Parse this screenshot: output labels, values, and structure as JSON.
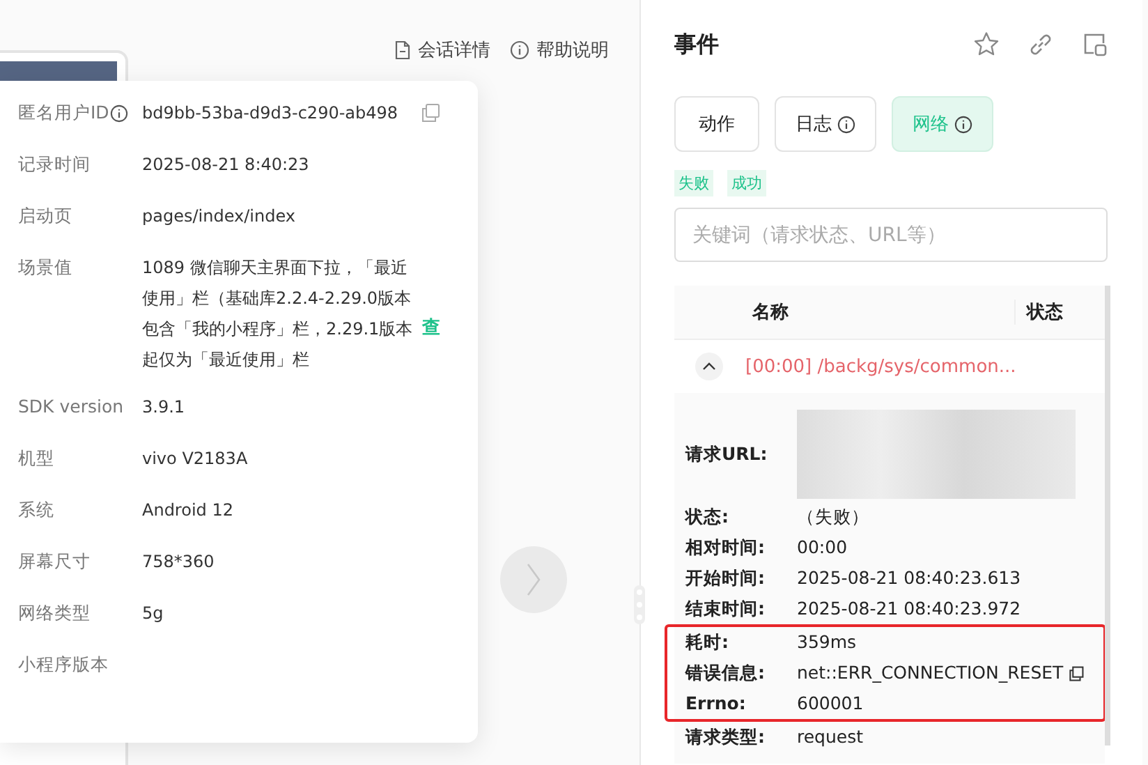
{
  "top_links": [
    {
      "kind": "doc",
      "label": "会话详情"
    },
    {
      "kind": "info",
      "label": "帮助说明"
    }
  ],
  "session_popover": {
    "rows": [
      {
        "label": "匿名用户ID",
        "info": true,
        "value": "bd9bb-53ba-d9d3-c290-ab498",
        "copy": true
      },
      {
        "label": "记录时间",
        "info": false,
        "value": "2025-08-21 8:40:23",
        "copy": false
      },
      {
        "label": "启动页",
        "info": false,
        "value": "pages/index/index",
        "copy": false
      },
      {
        "label": "场景值",
        "info": false,
        "value": "1089 微信聊天主界面下拉，「最近使用」栏（基础库2.2.4-2.29.0版本包含「我的小程序」栏，2.29.1版本起仅为「最近使用」栏",
        "copy": false,
        "link": "查"
      },
      {
        "label": "SDK version",
        "info": false,
        "value": "3.9.1",
        "copy": false
      },
      {
        "label": "机型",
        "info": false,
        "value": "vivo V2183A",
        "copy": false
      },
      {
        "label": "系统",
        "info": false,
        "value": "Android 12",
        "copy": false
      },
      {
        "label": "屏幕尺寸",
        "info": false,
        "value": "758*360",
        "copy": false
      },
      {
        "label": "网络类型",
        "info": false,
        "value": "5g",
        "copy": false
      },
      {
        "label": "小程序版本",
        "info": false,
        "copy": false
      }
    ]
  },
  "events_panel": {
    "title": "事件",
    "tabs": [
      {
        "label": "动作",
        "info": false,
        "selected": false
      },
      {
        "label": "日志",
        "info": true,
        "selected": false
      },
      {
        "label": "网络",
        "info": true,
        "selected": true
      }
    ],
    "filter_tags": [
      "失败",
      "成功"
    ],
    "search": {
      "placeholder": "关键词（请求状态、URL等）"
    },
    "table": {
      "columns": [
        "名称",
        "状态"
      ],
      "rows": [
        {
          "name": "[00:00] /backg/sys/common...",
          "expanded": true,
          "failed": true,
          "details": [
            {
              "kind": "redacted",
              "label": "请求URL:",
              "highlighted": false
            },
            {
              "kind": "text",
              "label": "状态:",
              "value": "（失败）",
              "highlighted": false
            },
            {
              "kind": "text",
              "label": "相对时间:",
              "value": "00:00",
              "highlighted": false
            },
            {
              "kind": "text",
              "label": "开始时间:",
              "value": "2025-08-21 08:40:23.613",
              "highlighted": false
            },
            {
              "kind": "text",
              "label": "结束时间:",
              "value": "2025-08-21 08:40:23.972",
              "highlighted": false
            },
            {
              "kind": "text",
              "label": "耗时:",
              "value": "359ms",
              "highlighted": true
            },
            {
              "kind": "copyable",
              "label": "错误信息:",
              "value": "net::ERR_CONNECTION_RESET",
              "highlighted": true
            },
            {
              "kind": "text",
              "label": "Errno:",
              "value": "600001",
              "highlighted": true
            },
            {
              "kind": "text",
              "label": "请求类型:",
              "value": "request",
              "highlighted": false
            }
          ]
        }
      ]
    }
  }
}
